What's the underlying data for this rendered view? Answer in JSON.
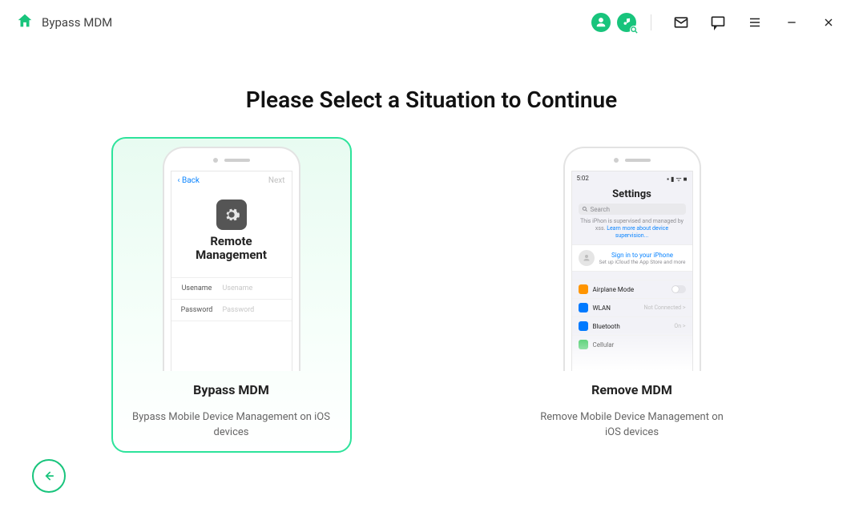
{
  "titlebar": {
    "title": "Bypass MDM"
  },
  "main": {
    "heading": "Please Select a Situation to Continue",
    "cards": [
      {
        "title": "Bypass MDM",
        "subtitle": "Bypass Mobile Device Management on iOS devices",
        "phone": {
          "back": "Back",
          "next": "Next",
          "heading_l1": "Remote",
          "heading_l2": "Management",
          "username_label": "Usename",
          "username_ph": "Usename",
          "password_label": "Password",
          "password_ph": "Password"
        }
      },
      {
        "title": "Remove MDM",
        "subtitle": "Remove Mobile Device Management on iOS devices",
        "phone": {
          "time": "5:02",
          "status": "▪ ▮ ᯤ ■",
          "heading": "Settings",
          "search_ph": "Search",
          "supervision": "This iPhon is supervised and managed by xss. ",
          "supervision_link": "Learn more about device supervision...",
          "signin_title": "Sign in to your iPhone",
          "signin_sub": "Set up iCloud the App Store and more",
          "items": [
            {
              "label": "Airplane Mode",
              "color": "#ff9500",
              "switch": true
            },
            {
              "label": "WLAN",
              "color": "#007aff",
              "val": "Not Connected >"
            },
            {
              "label": "Bluetooth",
              "color": "#007aff",
              "val": "On >"
            },
            {
              "label": "Cellular",
              "color": "#34c759",
              "val": ""
            }
          ]
        }
      }
    ]
  }
}
